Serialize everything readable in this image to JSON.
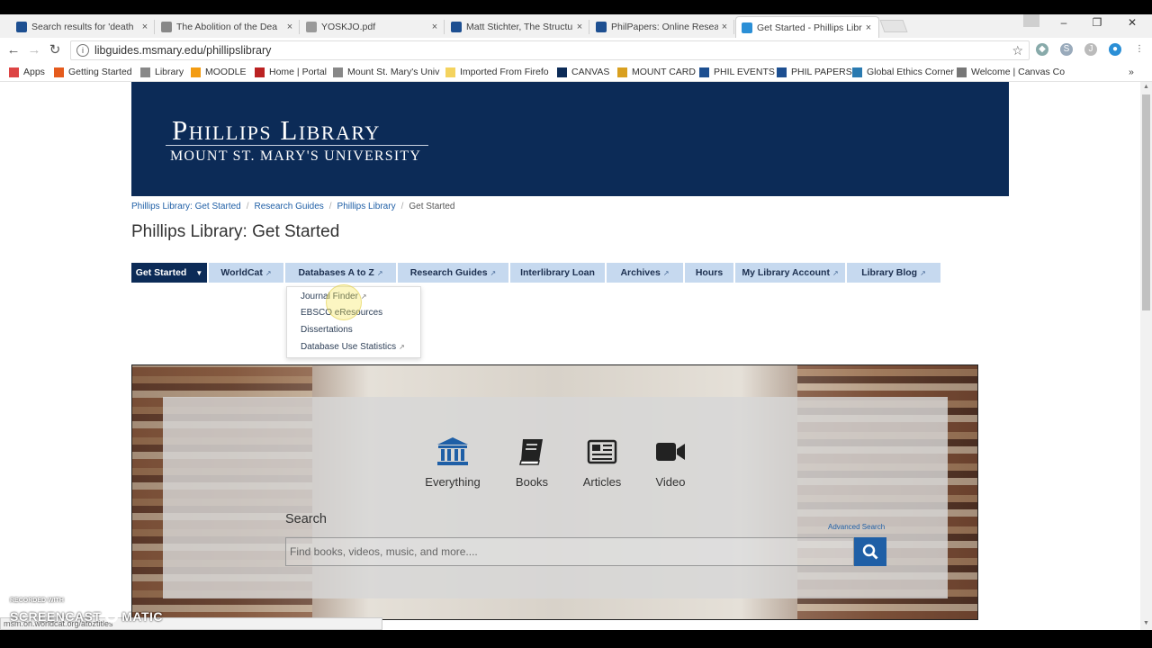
{
  "browser": {
    "tabs": [
      {
        "title": "Search results for 'death",
        "icon_color": "#1d4f91"
      },
      {
        "title": "The Abolition of the Dea",
        "icon_color": "#888888"
      },
      {
        "title": "YOSKJO.pdf",
        "icon_color": "#999999"
      },
      {
        "title": "Matt Stichter, The Structu",
        "icon_color": "#1d4f91"
      },
      {
        "title": "PhilPapers: Online Resea",
        "icon_color": "#1d4f91"
      },
      {
        "title": "Get Started - Phillips Libr",
        "icon_color": "#2b8fd6"
      }
    ],
    "active_tab": 5,
    "url": "libguides.msmary.edu/phillipslibrary",
    "bookmarks": [
      {
        "label": "Apps",
        "icon_color": "#d44"
      },
      {
        "label": "Getting Started",
        "icon_color": "#e55b1d"
      },
      {
        "label": "Library",
        "icon_color": "#888"
      },
      {
        "label": "MOODLE",
        "icon_color": "#f39c12"
      },
      {
        "label": "Home | Portal",
        "icon_color": "#b22"
      },
      {
        "label": "Mount St. Mary's Univ",
        "icon_color": "#888"
      },
      {
        "label": "Imported From Firefo",
        "icon_color": "#f4d35e"
      },
      {
        "label": "CANVAS",
        "icon_color": "#0c2b57"
      },
      {
        "label": "MOUNT CARD",
        "icon_color": "#d9a020"
      },
      {
        "label": "PHIL EVENTS",
        "icon_color": "#1d4f91"
      },
      {
        "label": "PHIL PAPERS",
        "icon_color": "#1d4f91"
      },
      {
        "label": "Global Ethics Corner",
        "icon_color": "#2a7ab0"
      },
      {
        "label": "Welcome | Canvas Co",
        "icon_color": "#777"
      }
    ],
    "status_url": "msm.on.worldcat.org/atoztitles"
  },
  "banner": {
    "title": "Phillips Library",
    "subtitle": "Mount St. Mary's University"
  },
  "breadcrumb": [
    {
      "label": "Phillips Library: Get Started",
      "link": true
    },
    {
      "label": "Research Guides",
      "link": true
    },
    {
      "label": "Phillips Library",
      "link": true
    },
    {
      "label": "Get Started",
      "link": false
    }
  ],
  "page_title": "Phillips Library: Get Started",
  "nav_tabs": [
    {
      "label": "Get Started",
      "ext": false,
      "active": true
    },
    {
      "label": "WorldCat",
      "ext": true
    },
    {
      "label": "Databases A to Z",
      "ext": true
    },
    {
      "label": "Research Guides",
      "ext": true
    },
    {
      "label": "Interlibrary Loan",
      "ext": false
    },
    {
      "label": "Archives",
      "ext": true
    },
    {
      "label": "Hours",
      "ext": false
    },
    {
      "label": "My Library Account",
      "ext": true
    },
    {
      "label": "Library Blog",
      "ext": true
    }
  ],
  "dropdown": [
    {
      "label": "Journal Finder",
      "ext": true
    },
    {
      "label": "EBSCO eResources",
      "ext": false
    },
    {
      "label": "Dissertations",
      "ext": false
    },
    {
      "label": "Database Use Statistics",
      "ext": true
    }
  ],
  "search": {
    "categories": [
      {
        "label": "Everything",
        "icon": "institution-icon"
      },
      {
        "label": "Books",
        "icon": "book-icon"
      },
      {
        "label": "Articles",
        "icon": "newspaper-icon"
      },
      {
        "label": "Video",
        "icon": "video-camera-icon"
      }
    ],
    "label": "Search",
    "advanced": "Advanced Search",
    "placeholder": "Find books, videos, music, and more....",
    "accent": "#1f5fa6"
  },
  "watermark": {
    "line1": "RECORDED WITH",
    "line2": "SCREENCAST",
    "line3": "MATIC"
  }
}
